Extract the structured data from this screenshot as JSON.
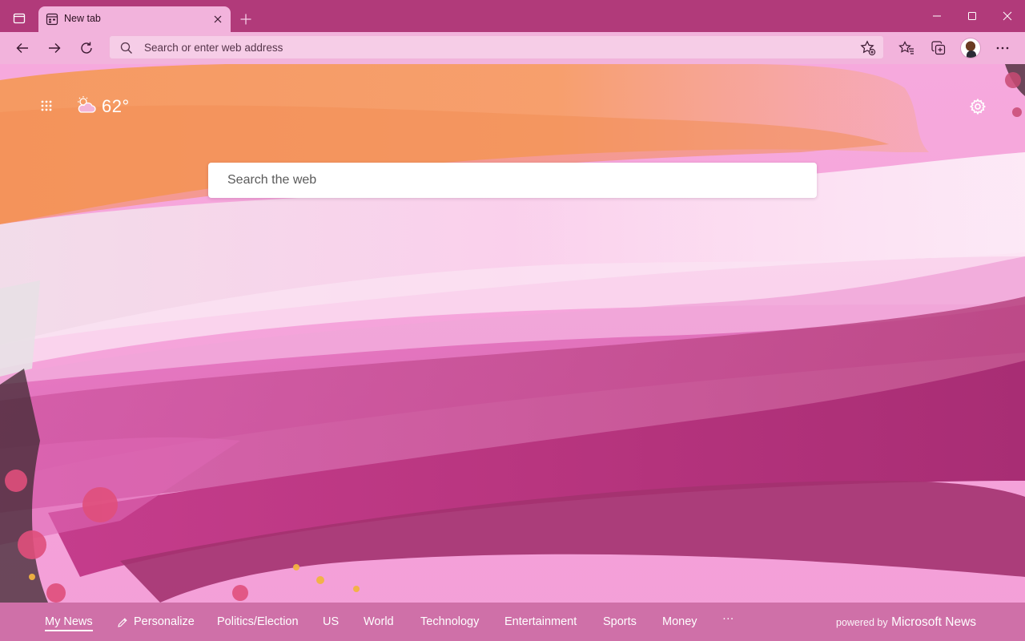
{
  "browser": {
    "tab": {
      "title": "New tab"
    },
    "address_bar": {
      "placeholder": "Search or enter web address"
    }
  },
  "new_tab_page": {
    "weather": {
      "temperature": "62°"
    },
    "search": {
      "placeholder": "Search the web"
    }
  },
  "news_bar": {
    "items": [
      {
        "label": "My News"
      },
      {
        "label": "Personalize"
      },
      {
        "label": "Politics/Election"
      },
      {
        "label": "US"
      },
      {
        "label": "World"
      },
      {
        "label": "Technology"
      },
      {
        "label": "Entertainment"
      },
      {
        "label": "Sports"
      },
      {
        "label": "Money"
      },
      {
        "label": "···"
      }
    ],
    "powered_by": "powered by",
    "brand": "Microsoft News"
  },
  "colors": {
    "title_bar": "#b13a7a",
    "toolbar": "#f2b3dc",
    "background": "#f6a9dd"
  }
}
